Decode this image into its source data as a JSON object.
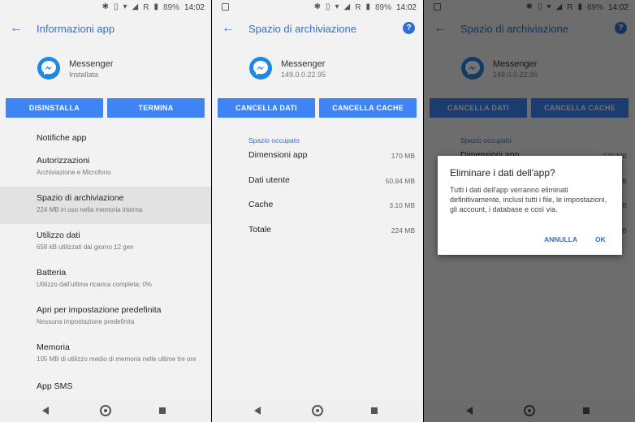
{
  "status": {
    "battery": "89%",
    "time": "14:02",
    "roaming": "R"
  },
  "screen1": {
    "title": "Informazioni app",
    "app_name": "Messenger",
    "app_status": "Installata",
    "buttons": {
      "left": "DISINSTALLA",
      "right": "TERMINA"
    },
    "items": [
      {
        "title": "Notifiche app",
        "sub": ""
      },
      {
        "title": "Autorizzazioni",
        "sub": "Archiviazione e Microfono"
      },
      {
        "title": "Spazio di archiviazione",
        "sub": "224 MB in uso nella memoria interna"
      },
      {
        "title": "Utilizzo dati",
        "sub": "658 kB utilizzati dal giorno 12 gen"
      },
      {
        "title": "Batteria",
        "sub": "Utilizzo dall'ultima ricarica completa: 0%"
      },
      {
        "title": "Apri per impostazione predefinita",
        "sub": "Nessuna impostazione predefinita"
      },
      {
        "title": "Memoria",
        "sub": "105 MB di utilizzo medio di memoria nelle ultime tre ore"
      },
      {
        "title": "App SMS",
        "sub": ""
      }
    ]
  },
  "screen2": {
    "title": "Spazio di archiviazione",
    "help": "?",
    "app_name": "Messenger",
    "app_version": "149.0.0.22.95",
    "buttons": {
      "left": "CANCELLA DATI",
      "right": "CANCELLA CACHE"
    },
    "section_title": "Spazio occupato",
    "rows": [
      {
        "label": "Dimensioni app",
        "value": "170 MB"
      },
      {
        "label": "Dati utente",
        "value": "50,94 MB"
      },
      {
        "label": "Cache",
        "value": "3,10 MB"
      },
      {
        "label": "Totale",
        "value": "224 MB"
      }
    ]
  },
  "dialog": {
    "title": "Eliminare i dati dell'app?",
    "body": "Tutti i dati dell'app verranno eliminati definitivamente, inclusi tutti i file, le impostazioni, gli account, i database e così via.",
    "cancel": "ANNULLA",
    "ok": "OK"
  },
  "icons": {
    "back": "arrow-back-icon",
    "bluetooth": "bluetooth-icon",
    "vibrate": "vibrate-icon",
    "wifi": "wifi-icon",
    "signal": "signal-icon",
    "battery": "battery-icon",
    "image": "image-notification-icon"
  },
  "colors": {
    "accent": "#2f6fd0",
    "button": "#3e84f5",
    "messenger": "#1e88e5"
  }
}
